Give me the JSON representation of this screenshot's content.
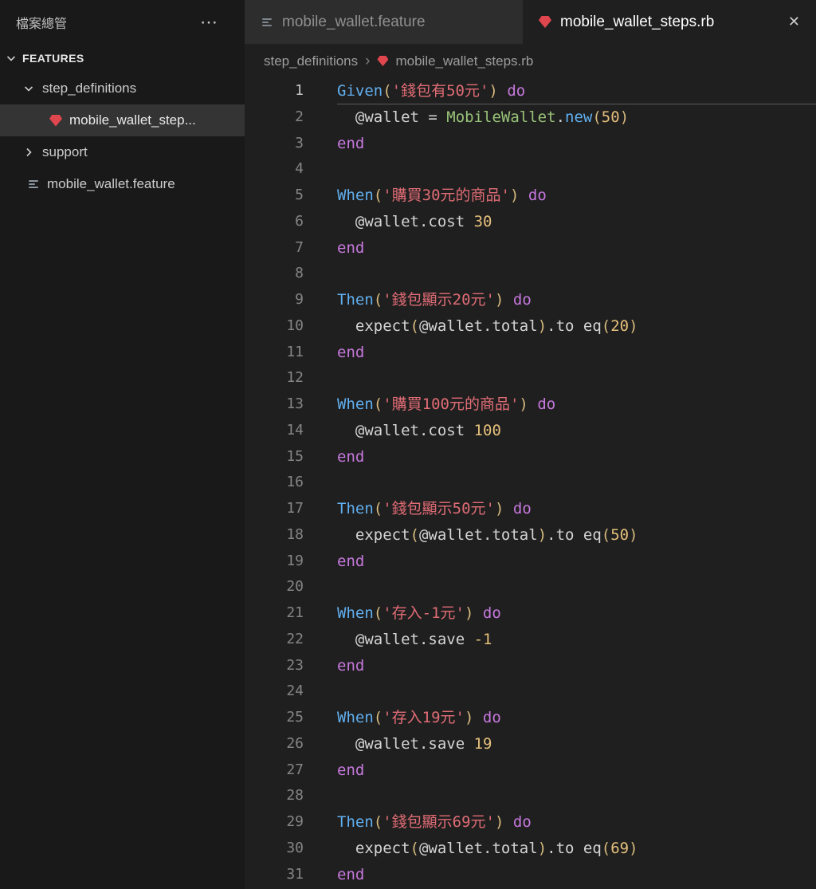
{
  "colors": {
    "ruby": "#e0464e",
    "fn": "#61afef",
    "str": "#e06c75",
    "kw": "#c678dd",
    "cls": "#98c379",
    "num": "#e5c07b",
    "par": "#d7ba7d",
    "pln": "#d4d4d4",
    "editor_bg": "#1f1f1f",
    "sidebar_bg": "#191919",
    "tab_inactive_bg": "#2d2d2d"
  },
  "sidebar": {
    "title": "檔案總管",
    "actions": "⋯",
    "section_label": "FEATURES",
    "items": [
      {
        "label": "step_definitions",
        "type": "folder",
        "expanded": true
      },
      {
        "label": "mobile_wallet_step...",
        "type": "ruby-file",
        "selected": true
      },
      {
        "label": "support",
        "type": "folder",
        "expanded": false
      },
      {
        "label": "mobile_wallet.feature",
        "type": "feature-file"
      }
    ]
  },
  "tabs": [
    {
      "label": "mobile_wallet.feature",
      "icon": "feature-file-icon",
      "active": false
    },
    {
      "label": "mobile_wallet_steps.rb",
      "icon": "ruby-icon",
      "active": true,
      "close": "✕"
    }
  ],
  "breadcrumb": {
    "folder": "step_definitions",
    "separator": "›",
    "file": "mobile_wallet_steps.rb"
  },
  "editor": {
    "language": "ruby",
    "lines": [
      {
        "n": 1,
        "current": true,
        "t": [
          [
            "fn",
            "Given"
          ],
          [
            "par",
            "("
          ],
          [
            "str",
            "'錢包有50元'"
          ],
          [
            "par",
            ")"
          ],
          [
            "pln",
            " "
          ],
          [
            "kw",
            "do"
          ]
        ]
      },
      {
        "n": 2,
        "t": [
          [
            "pln",
            "  @wallet = "
          ],
          [
            "cls",
            "MobileWallet"
          ],
          [
            "pln",
            "."
          ],
          [
            "fn",
            "new"
          ],
          [
            "par",
            "("
          ],
          [
            "num",
            "50"
          ],
          [
            "par",
            ")"
          ]
        ]
      },
      {
        "n": 3,
        "t": [
          [
            "kw",
            "end"
          ]
        ]
      },
      {
        "n": 4,
        "t": []
      },
      {
        "n": 5,
        "t": [
          [
            "fn",
            "When"
          ],
          [
            "par",
            "("
          ],
          [
            "str",
            "'購買30元的商品'"
          ],
          [
            "par",
            ")"
          ],
          [
            "pln",
            " "
          ],
          [
            "kw",
            "do"
          ]
        ]
      },
      {
        "n": 6,
        "t": [
          [
            "pln",
            "  @wallet.cost "
          ],
          [
            "num",
            "30"
          ]
        ]
      },
      {
        "n": 7,
        "t": [
          [
            "kw",
            "end"
          ]
        ]
      },
      {
        "n": 8,
        "t": []
      },
      {
        "n": 9,
        "t": [
          [
            "fn",
            "Then"
          ],
          [
            "par",
            "("
          ],
          [
            "str",
            "'錢包顯示20元'"
          ],
          [
            "par",
            ")"
          ],
          [
            "pln",
            " "
          ],
          [
            "kw",
            "do"
          ]
        ]
      },
      {
        "n": 10,
        "t": [
          [
            "pln",
            "  expect"
          ],
          [
            "par",
            "("
          ],
          [
            "pln",
            "@wallet.total"
          ],
          [
            "par",
            ")"
          ],
          [
            "pln",
            ".to eq"
          ],
          [
            "par",
            "("
          ],
          [
            "num",
            "20"
          ],
          [
            "par",
            ")"
          ]
        ]
      },
      {
        "n": 11,
        "t": [
          [
            "kw",
            "end"
          ]
        ]
      },
      {
        "n": 12,
        "t": []
      },
      {
        "n": 13,
        "t": [
          [
            "fn",
            "When"
          ],
          [
            "par",
            "("
          ],
          [
            "str",
            "'購買100元的商品'"
          ],
          [
            "par",
            ")"
          ],
          [
            "pln",
            " "
          ],
          [
            "kw",
            "do"
          ]
        ]
      },
      {
        "n": 14,
        "t": [
          [
            "pln",
            "  @wallet.cost "
          ],
          [
            "num",
            "100"
          ]
        ]
      },
      {
        "n": 15,
        "t": [
          [
            "kw",
            "end"
          ]
        ]
      },
      {
        "n": 16,
        "t": []
      },
      {
        "n": 17,
        "t": [
          [
            "fn",
            "Then"
          ],
          [
            "par",
            "("
          ],
          [
            "str",
            "'錢包顯示50元'"
          ],
          [
            "par",
            ")"
          ],
          [
            "pln",
            " "
          ],
          [
            "kw",
            "do"
          ]
        ]
      },
      {
        "n": 18,
        "t": [
          [
            "pln",
            "  expect"
          ],
          [
            "par",
            "("
          ],
          [
            "pln",
            "@wallet.total"
          ],
          [
            "par",
            ")"
          ],
          [
            "pln",
            ".to eq"
          ],
          [
            "par",
            "("
          ],
          [
            "num",
            "50"
          ],
          [
            "par",
            ")"
          ]
        ]
      },
      {
        "n": 19,
        "t": [
          [
            "kw",
            "end"
          ]
        ]
      },
      {
        "n": 20,
        "t": []
      },
      {
        "n": 21,
        "t": [
          [
            "fn",
            "When"
          ],
          [
            "par",
            "("
          ],
          [
            "str",
            "'存入-1元'"
          ],
          [
            "par",
            ")"
          ],
          [
            "pln",
            " "
          ],
          [
            "kw",
            "do"
          ]
        ]
      },
      {
        "n": 22,
        "t": [
          [
            "pln",
            "  @wallet.save "
          ],
          [
            "num",
            "-1"
          ]
        ]
      },
      {
        "n": 23,
        "t": [
          [
            "kw",
            "end"
          ]
        ]
      },
      {
        "n": 24,
        "t": []
      },
      {
        "n": 25,
        "t": [
          [
            "fn",
            "When"
          ],
          [
            "par",
            "("
          ],
          [
            "str",
            "'存入19元'"
          ],
          [
            "par",
            ")"
          ],
          [
            "pln",
            " "
          ],
          [
            "kw",
            "do"
          ]
        ]
      },
      {
        "n": 26,
        "t": [
          [
            "pln",
            "  @wallet.save "
          ],
          [
            "num",
            "19"
          ]
        ]
      },
      {
        "n": 27,
        "t": [
          [
            "kw",
            "end"
          ]
        ]
      },
      {
        "n": 28,
        "t": []
      },
      {
        "n": 29,
        "t": [
          [
            "fn",
            "Then"
          ],
          [
            "par",
            "("
          ],
          [
            "str",
            "'錢包顯示69元'"
          ],
          [
            "par",
            ")"
          ],
          [
            "pln",
            " "
          ],
          [
            "kw",
            "do"
          ]
        ]
      },
      {
        "n": 30,
        "t": [
          [
            "pln",
            "  expect"
          ],
          [
            "par",
            "("
          ],
          [
            "pln",
            "@wallet.total"
          ],
          [
            "par",
            ")"
          ],
          [
            "pln",
            ".to eq"
          ],
          [
            "par",
            "("
          ],
          [
            "num",
            "69"
          ],
          [
            "par",
            ")"
          ]
        ]
      },
      {
        "n": 31,
        "t": [
          [
            "kw",
            "end"
          ]
        ]
      }
    ]
  }
}
